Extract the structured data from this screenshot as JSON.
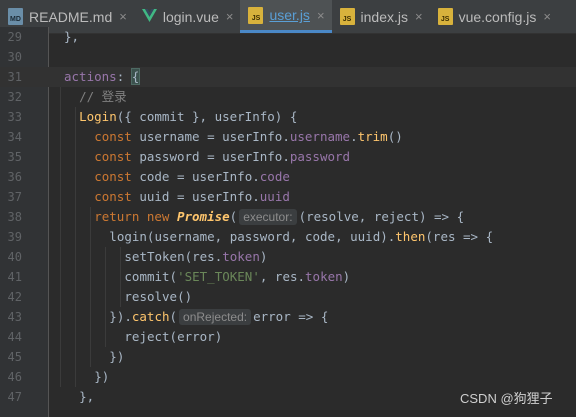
{
  "tabs": [
    {
      "label": "README.md",
      "icon": "markdown-file-icon",
      "active": false
    },
    {
      "label": "login.vue",
      "icon": "vue-file-icon",
      "active": false
    },
    {
      "label": "user.js",
      "icon": "js-file-icon",
      "active": true
    },
    {
      "label": "index.js",
      "icon": "js-file-icon",
      "active": false
    },
    {
      "label": "vue.config.js",
      "icon": "js-file-icon",
      "active": false
    }
  ],
  "icon_text": {
    "md": "MD",
    "js": "JS"
  },
  "close_glyph": "×",
  "hints": {
    "executor": "executor:",
    "on_rejected": "onRejected:"
  },
  "lines": [
    {
      "n": "29",
      "indent": 1,
      "segs": [
        [
          "},",
          ""
        ]
      ]
    },
    {
      "n": "30",
      "indent": 0,
      "segs": []
    },
    {
      "n": "31",
      "indent": 1,
      "segs": [
        [
          "actions",
          "prop"
        ],
        [
          ": ",
          ""
        ],
        [
          "{",
          "brace"
        ]
      ]
    },
    {
      "n": "32",
      "indent": 2,
      "segs": [
        [
          "// 登录",
          "cmt"
        ]
      ]
    },
    {
      "n": "33",
      "indent": 2,
      "segs": [
        [
          "Login",
          "fn"
        ],
        [
          "({ commit }, userInfo) {",
          ""
        ]
      ]
    },
    {
      "n": "34",
      "indent": 3,
      "segs": [
        [
          "const ",
          "kw"
        ],
        [
          "username = userInfo.",
          ""
        ],
        [
          "username",
          "prop"
        ],
        [
          ".",
          ""
        ],
        [
          "trim",
          "fn"
        ],
        [
          "()",
          ""
        ]
      ]
    },
    {
      "n": "35",
      "indent": 3,
      "segs": [
        [
          "const ",
          "kw"
        ],
        [
          "password = userInfo.",
          ""
        ],
        [
          "password",
          "prop"
        ]
      ]
    },
    {
      "n": "36",
      "indent": 3,
      "segs": [
        [
          "const ",
          "kw"
        ],
        [
          "code = userInfo.",
          ""
        ],
        [
          "code",
          "prop"
        ]
      ]
    },
    {
      "n": "37",
      "indent": 3,
      "segs": [
        [
          "const ",
          "kw"
        ],
        [
          "uuid = userInfo.",
          ""
        ],
        [
          "uuid",
          "prop"
        ]
      ]
    },
    {
      "n": "38",
      "indent": 3,
      "segs": [
        [
          "return new ",
          "kw"
        ],
        [
          "Promise",
          "promise"
        ],
        [
          "(",
          ""
        ],
        [
          "executor",
          "hint"
        ],
        [
          "(resolve, reject) => {",
          ""
        ]
      ]
    },
    {
      "n": "39",
      "indent": 4,
      "segs": [
        [
          "login(username, password, code, uuid).",
          ""
        ],
        [
          "then",
          "fn"
        ],
        [
          "(res => {",
          ""
        ]
      ]
    },
    {
      "n": "40",
      "indent": 5,
      "segs": [
        [
          "setToken(res.",
          ""
        ],
        [
          "token",
          "prop"
        ],
        [
          ")",
          ""
        ]
      ]
    },
    {
      "n": "41",
      "indent": 5,
      "segs": [
        [
          "commit(",
          ""
        ],
        [
          "'SET_TOKEN'",
          "str"
        ],
        [
          ", res.",
          ""
        ],
        [
          "token",
          "prop"
        ],
        [
          ")",
          ""
        ]
      ]
    },
    {
      "n": "42",
      "indent": 5,
      "segs": [
        [
          "resolve()",
          ""
        ]
      ]
    },
    {
      "n": "43",
      "indent": 4,
      "segs": [
        [
          "}).",
          ""
        ],
        [
          "catch",
          "fn"
        ],
        [
          "(",
          ""
        ],
        [
          "on_rejected",
          "hint"
        ],
        [
          "error => {",
          ""
        ]
      ]
    },
    {
      "n": "44",
      "indent": 5,
      "segs": [
        [
          "reject(error)",
          ""
        ]
      ]
    },
    {
      "n": "45",
      "indent": 4,
      "segs": [
        [
          "})",
          ""
        ]
      ]
    },
    {
      "n": "46",
      "indent": 3,
      "segs": [
        [
          "})",
          ""
        ]
      ]
    },
    {
      "n": "47",
      "indent": 2,
      "segs": [
        [
          "},",
          ""
        ]
      ]
    }
  ],
  "current_line": "31",
  "watermark": "CSDN @狗狸子",
  "colors": {
    "background": "#2b2b2b",
    "keyword": "#cc7832",
    "property": "#9876aa",
    "function": "#ffc66d",
    "string": "#6a8759",
    "comment": "#808080",
    "active_tab_accent": "#4a88c7"
  }
}
